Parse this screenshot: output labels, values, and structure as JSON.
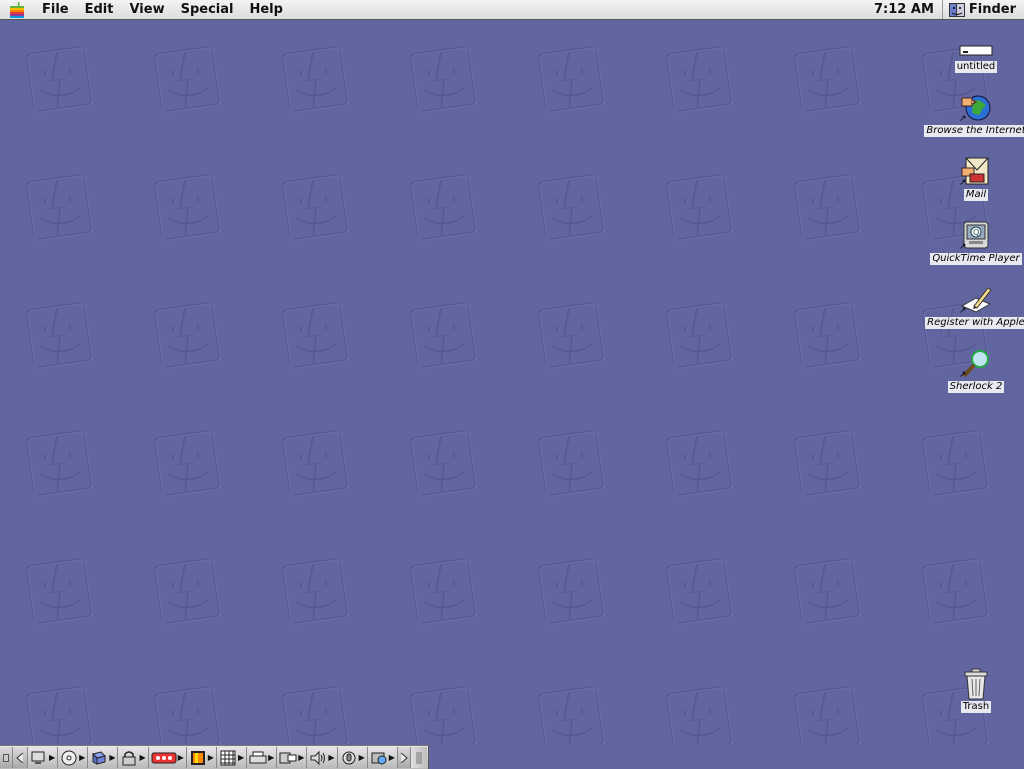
{
  "menubar": {
    "apple_icon": "apple-icon",
    "items": [
      {
        "label": "File"
      },
      {
        "label": "Edit"
      },
      {
        "label": "View"
      },
      {
        "label": "Special"
      },
      {
        "label": "Help"
      }
    ],
    "clock": "7:12 AM",
    "app_name": "Finder"
  },
  "desktop": {
    "background_color": "#6165a0",
    "icons": [
      {
        "label": "untitled",
        "icon": "disk-icon"
      },
      {
        "label": "Browse the Internet",
        "icon": "globe-icon"
      },
      {
        "label": "Mail",
        "icon": "mail-icon"
      },
      {
        "label": "QuickTime Player",
        "icon": "quicktime-icon"
      },
      {
        "label": "Register with Apple",
        "icon": "register-icon"
      },
      {
        "label": "Sherlock 2",
        "icon": "sherlock-icon"
      },
      {
        "label": "Trash",
        "icon": "trash-icon"
      }
    ]
  },
  "control_strip": {
    "modules": [
      {
        "icon": "cd-icon"
      },
      {
        "icon": "monitor-icon"
      },
      {
        "icon": "clock-icon"
      },
      {
        "icon": "file-sharing-icon"
      },
      {
        "icon": "lock-icon"
      },
      {
        "icon": "keychain-icon"
      },
      {
        "icon": "remote-icon"
      },
      {
        "icon": "monitor-bit-depth-icon"
      },
      {
        "icon": "printer-icon"
      },
      {
        "icon": "speaker-icon"
      },
      {
        "icon": "microphone-icon"
      },
      {
        "icon": "web-sharing-icon"
      }
    ]
  }
}
